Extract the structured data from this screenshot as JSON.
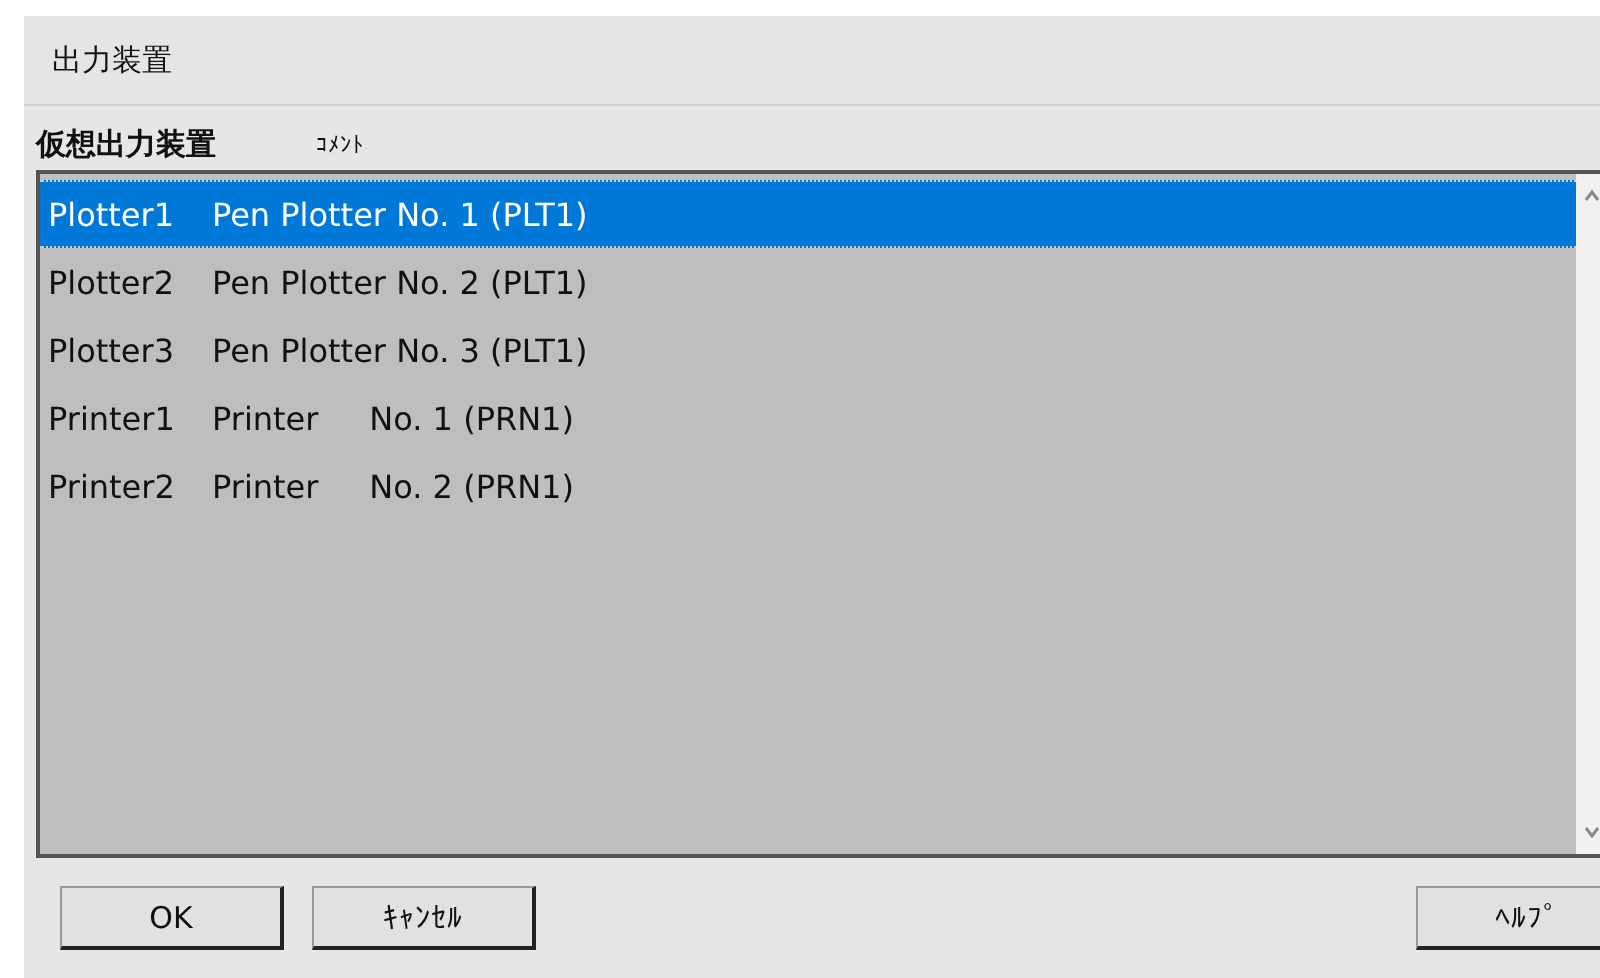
{
  "window": {
    "title": "出力装置"
  },
  "columns": [
    "仮想出力装置",
    "ｺﾒﾝﾄ"
  ],
  "rows": [
    {
      "name": "Plotter1",
      "comment": "Pen Plotter No. 1 (PLT1)",
      "selected": true
    },
    {
      "name": "Plotter2",
      "comment": "Pen Plotter No. 2 (PLT1)",
      "selected": false
    },
    {
      "name": "Plotter3",
      "comment": "Pen Plotter No. 3 (PLT1)",
      "selected": false
    },
    {
      "name": "Printer1",
      "comment": "Printer     No. 1 (PRN1)",
      "selected": false
    },
    {
      "name": "Printer2",
      "comment": "Printer     No. 2 (PRN1)",
      "selected": false
    }
  ],
  "buttons": [
    "OK",
    "ｷｬﾝｾﾙ",
    "ﾍﾙﾌﾟ"
  ]
}
